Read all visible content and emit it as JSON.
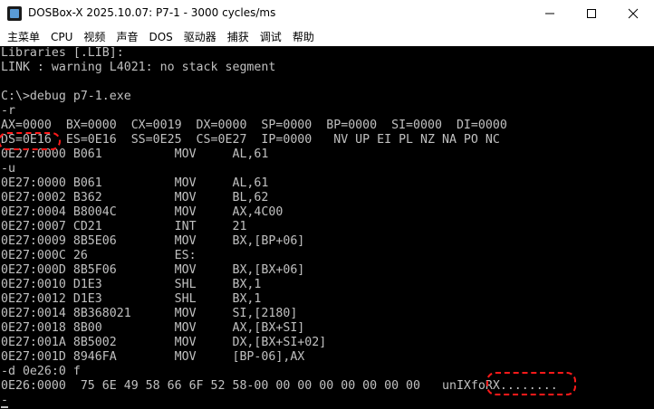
{
  "window": {
    "title": "DOSBox-X 2025.10.07: P7-1 - 3000 cycles/ms",
    "minimize_icon": "minimize-icon",
    "maximize_icon": "maximize-icon",
    "close_icon": "close-icon"
  },
  "menu": [
    "主菜单",
    "CPU",
    "视频",
    "声音",
    "DOS",
    "驱动器",
    "捕获",
    "调试",
    "帮助"
  ],
  "console": {
    "lines": [
      "Libraries [.LIB]:",
      "LINK : warning L4021: no stack segment",
      "",
      "C:\\>debug p7-1.exe",
      "-r",
      "AX=0000  BX=0000  CX=0019  DX=0000  SP=0000  BP=0000  SI=0000  DI=0000",
      "DS=0E16  ES=0E16  SS=0E25  CS=0E27  IP=0000   NV UP EI PL NZ NA PO NC",
      "0E27:0000 B061          MOV     AL,61",
      "-u",
      "0E27:0000 B061          MOV     AL,61",
      "0E27:0002 B362          MOV     BL,62",
      "0E27:0004 B8004C        MOV     AX,4C00",
      "0E27:0007 CD21          INT     21",
      "0E27:0009 8B5E06        MOV     BX,[BP+06]",
      "0E27:000C 26            ES:",
      "0E27:000D 8B5F06        MOV     BX,[BX+06]",
      "0E27:0010 D1E3          SHL     BX,1",
      "0E27:0012 D1E3          SHL     BX,1",
      "0E27:0014 8B368021      MOV     SI,[2180]",
      "0E27:0018 8B00          MOV     AX,[BX+SI]",
      "0E27:001A 8B5002        MOV     DX,[BX+SI+02]",
      "0E27:001D 8946FA        MOV     [BP-06],AX",
      "-d 0e26:0 f",
      "0E26:0000  75 6E 49 58 66 6F 52 58-00 00 00 00 00 00 00 00   unIXfoRX........",
      "-"
    ]
  },
  "colors": {
    "console_bg": "#000000",
    "console_text": "#c0c0c0",
    "highlight": "#ff1a1a"
  }
}
